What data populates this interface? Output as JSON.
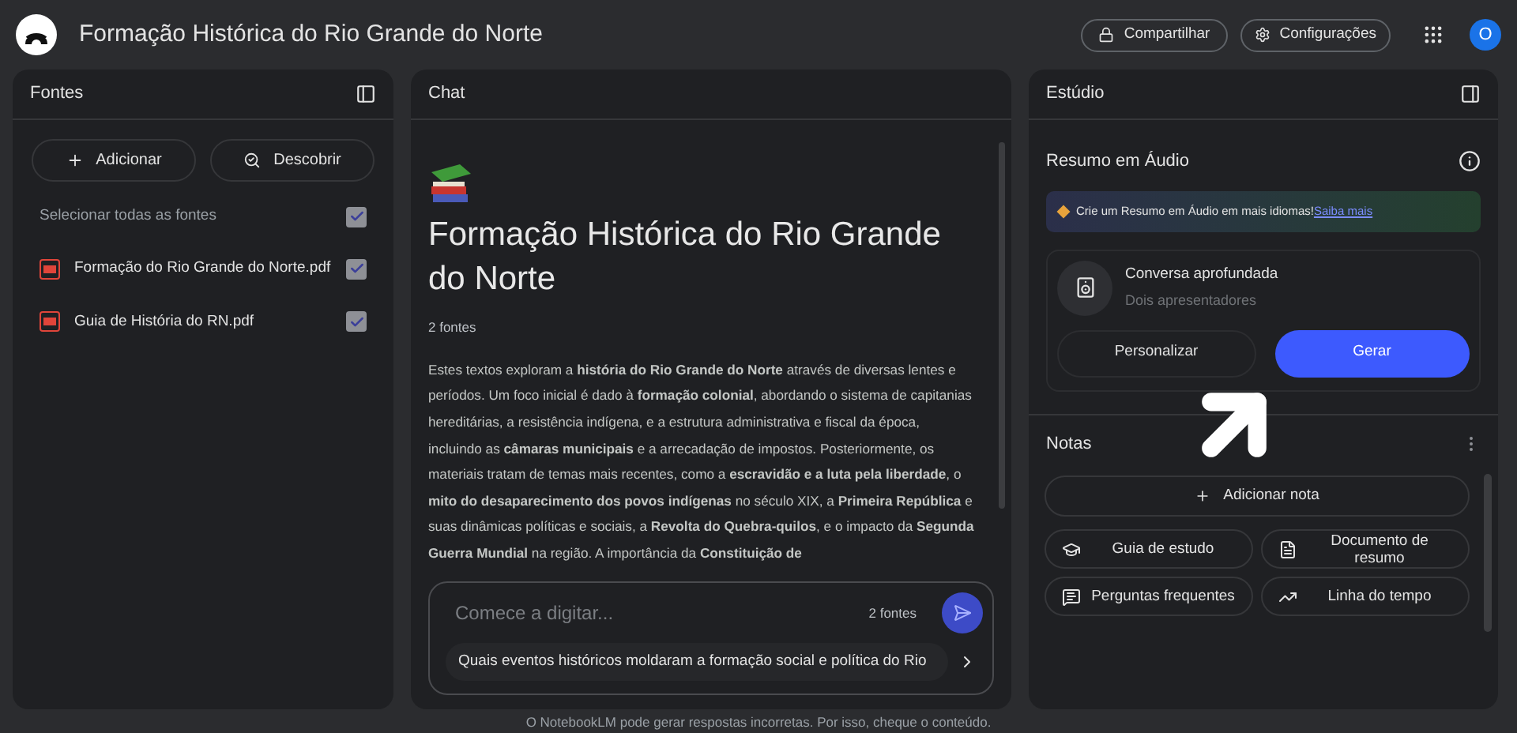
{
  "header": {
    "title": "Formação Histórica do Rio Grande do Norte",
    "share": "Compartilhar",
    "settings": "Configurações",
    "avatar": "O"
  },
  "sources": {
    "title": "Fontes",
    "add": "Adicionar",
    "discover": "Descobrir",
    "select_all": {
      "label": "Selecionar todas as fontes",
      "checked": true
    },
    "items": [
      {
        "name": "Formação do Rio Grande do Norte.pdf",
        "checked": true
      },
      {
        "name": "Guia de História do RN.pdf",
        "checked": true
      }
    ]
  },
  "chat": {
    "title": "Chat",
    "notebook_title": "Formação Histórica do Rio Grande do Norte",
    "source_count": "2 fontes",
    "summary": "Estes textos exploram a **história do Rio Grande do Norte** através de diversas lentes e períodos. Um foco inicial é dado à **formação colonial**, abordando o sistema de capitanias hereditárias, a resistência indígena, e a estrutura administrativa e fiscal da época, incluindo as **câmaras municipais** e a arrecadação de impostos. Posteriormente, os materiais tratam de temas mais recentes, como a **escravidão e a luta pela liberdade**, o **mito do desaparecimento dos povos indígenas** no século XIX, a **Primeira República** e suas dinâmicas políticas e sociais, a **Revolta do Quebra-quilos**, e o impacto da **Segunda Guerra Mundial** na região. A importância da **Constituição de**",
    "input": {
      "placeholder": "Comece a digitar...",
      "source_count": "2 fontes"
    },
    "suggestion": "Quais eventos históricos moldaram a formação social e política do Rio"
  },
  "studio": {
    "title": "Estúdio",
    "audio": {
      "title": "Resumo em Áudio",
      "banner": "Crie um Resumo em Áudio em mais idiomas!",
      "banner_link": "Saiba mais",
      "format_title": "Conversa aprofundada",
      "format_subtitle": "Dois apresentadores",
      "customize": "Personalizar",
      "generate": "Gerar"
    },
    "notes": {
      "title": "Notas",
      "add": "Adicionar nota",
      "actions": [
        {
          "kind": "study",
          "label": "Guia de estudo"
        },
        {
          "kind": "doc",
          "label": "Documento de resumo"
        },
        {
          "kind": "faq",
          "label": "Perguntas frequentes"
        },
        {
          "kind": "timeline",
          "label": "Linha do tempo"
        }
      ]
    }
  },
  "footer": "O NotebookLM pode gerar respostas incorretas. Por isso, cheque o conteúdo."
}
